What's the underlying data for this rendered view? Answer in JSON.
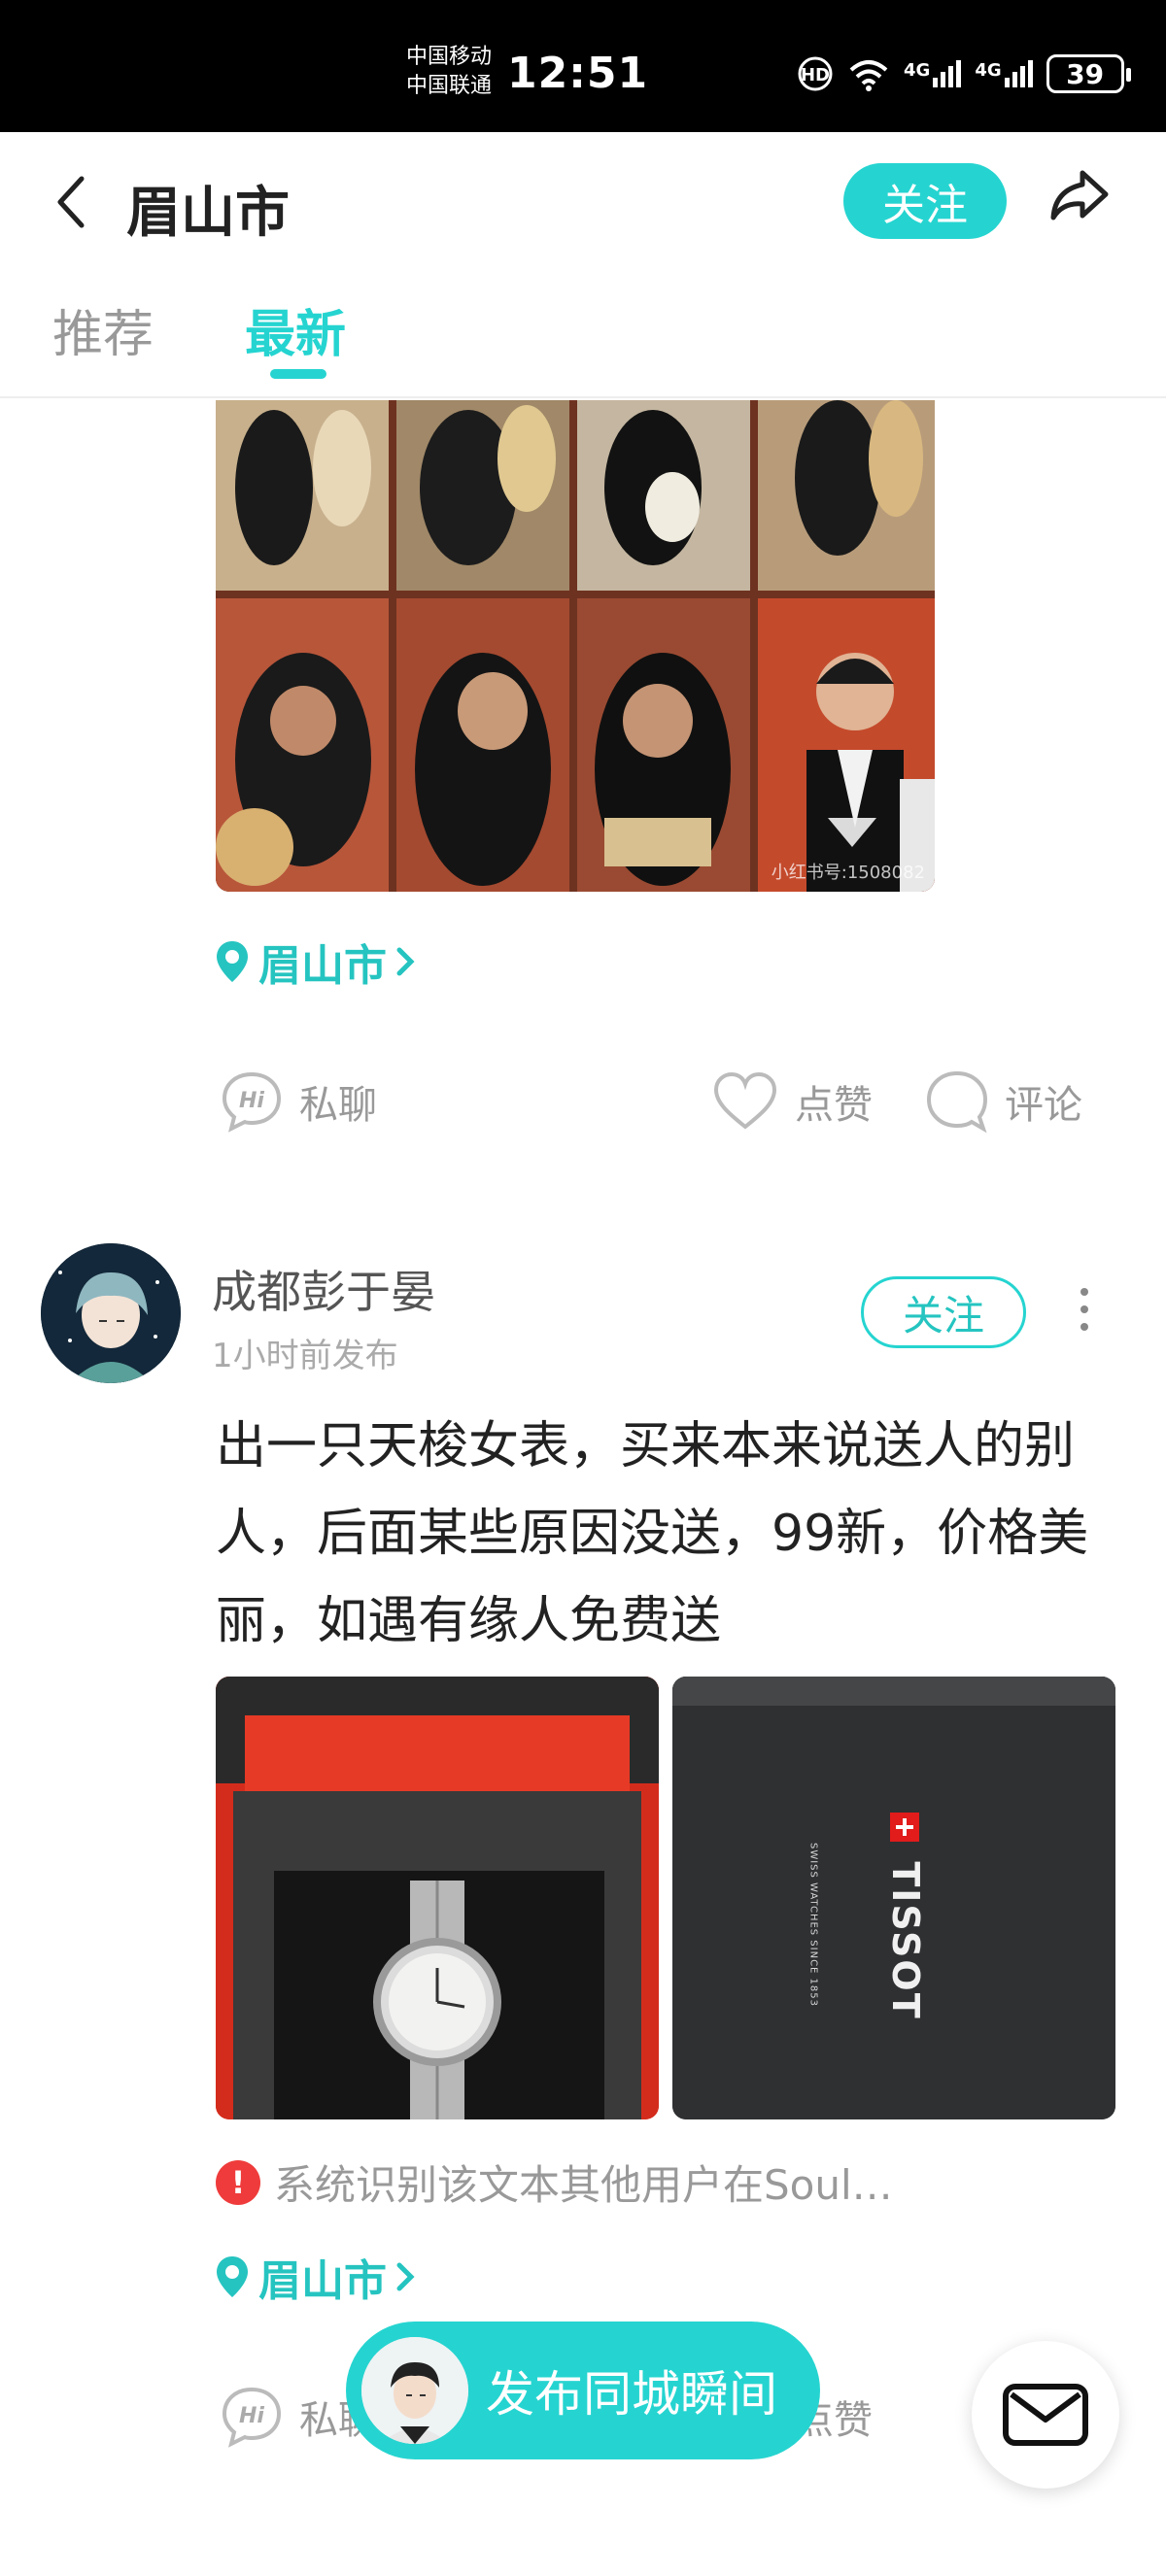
{
  "status_bar": {
    "carrier_1": "中国移动",
    "carrier_2": "中国联通",
    "time": "12:51",
    "battery": "39",
    "signal_1": "4G",
    "signal_2": "4G"
  },
  "header": {
    "title": "眉山市",
    "follow_label": "关注"
  },
  "tabs": [
    {
      "label": "推荐",
      "active": false
    },
    {
      "label": "最新",
      "active": true
    }
  ],
  "posts": [
    {
      "image_watermark": "小红书号:1508082",
      "location": "眉山市",
      "actions": {
        "chat": "私聊",
        "like": "点赞",
        "comment": "评论"
      }
    },
    {
      "username": "成都彭于晏",
      "time": "1小时前发布",
      "follow_label": "关注",
      "content": "出一只天梭女表，买来本来说送人的别人，后面某些原因没送，99新，价格美丽，如遇有缘人免费送",
      "watch_brand": "TISSOT",
      "watch_brand_sub": "SWISS WATCHES SINCE 1853",
      "warning": "系统识别该文本其他用户在Soul…",
      "location": "眉山市",
      "actions": {
        "chat": "私聊",
        "like": "点赞"
      }
    }
  ],
  "publish_button": "发布同城瞬间",
  "colors": {
    "accent": "#25d4d0",
    "warning": "#ef3b3b"
  }
}
